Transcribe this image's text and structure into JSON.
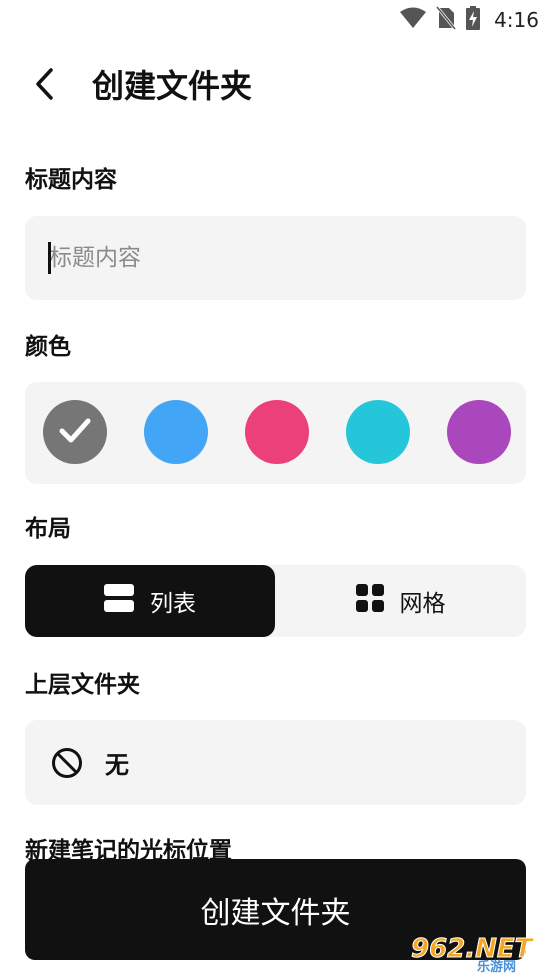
{
  "status_bar": {
    "time": "4:16"
  },
  "header": {
    "title": "创建文件夹"
  },
  "title_section": {
    "label": "标题内容",
    "placeholder": "标题内容",
    "value": ""
  },
  "color_section": {
    "label": "颜色",
    "swatches": [
      {
        "color": "#767676",
        "selected": true
      },
      {
        "color": "#42A5F5",
        "selected": false
      },
      {
        "color": "#EC407A",
        "selected": false
      },
      {
        "color": "#26C6DA",
        "selected": false
      },
      {
        "color": "#AB47BC",
        "selected": false
      }
    ]
  },
  "layout_section": {
    "label": "布局",
    "options": [
      {
        "label": "列表",
        "icon": "list-icon",
        "selected": true
      },
      {
        "label": "网格",
        "icon": "grid-icon",
        "selected": false
      }
    ]
  },
  "parent_folder_section": {
    "label": "上层文件夹",
    "value": "无",
    "icon": "block-icon"
  },
  "cursor_section": {
    "label": "新建笔记的光标位置"
  },
  "actions": {
    "create_label": "创建文件夹"
  },
  "watermark": {
    "text": "962.NET",
    "subtext": "乐游网"
  },
  "colors": {
    "accent": "#111111",
    "card_bg": "#f4f4f4",
    "placeholder": "#8b8b8b"
  }
}
